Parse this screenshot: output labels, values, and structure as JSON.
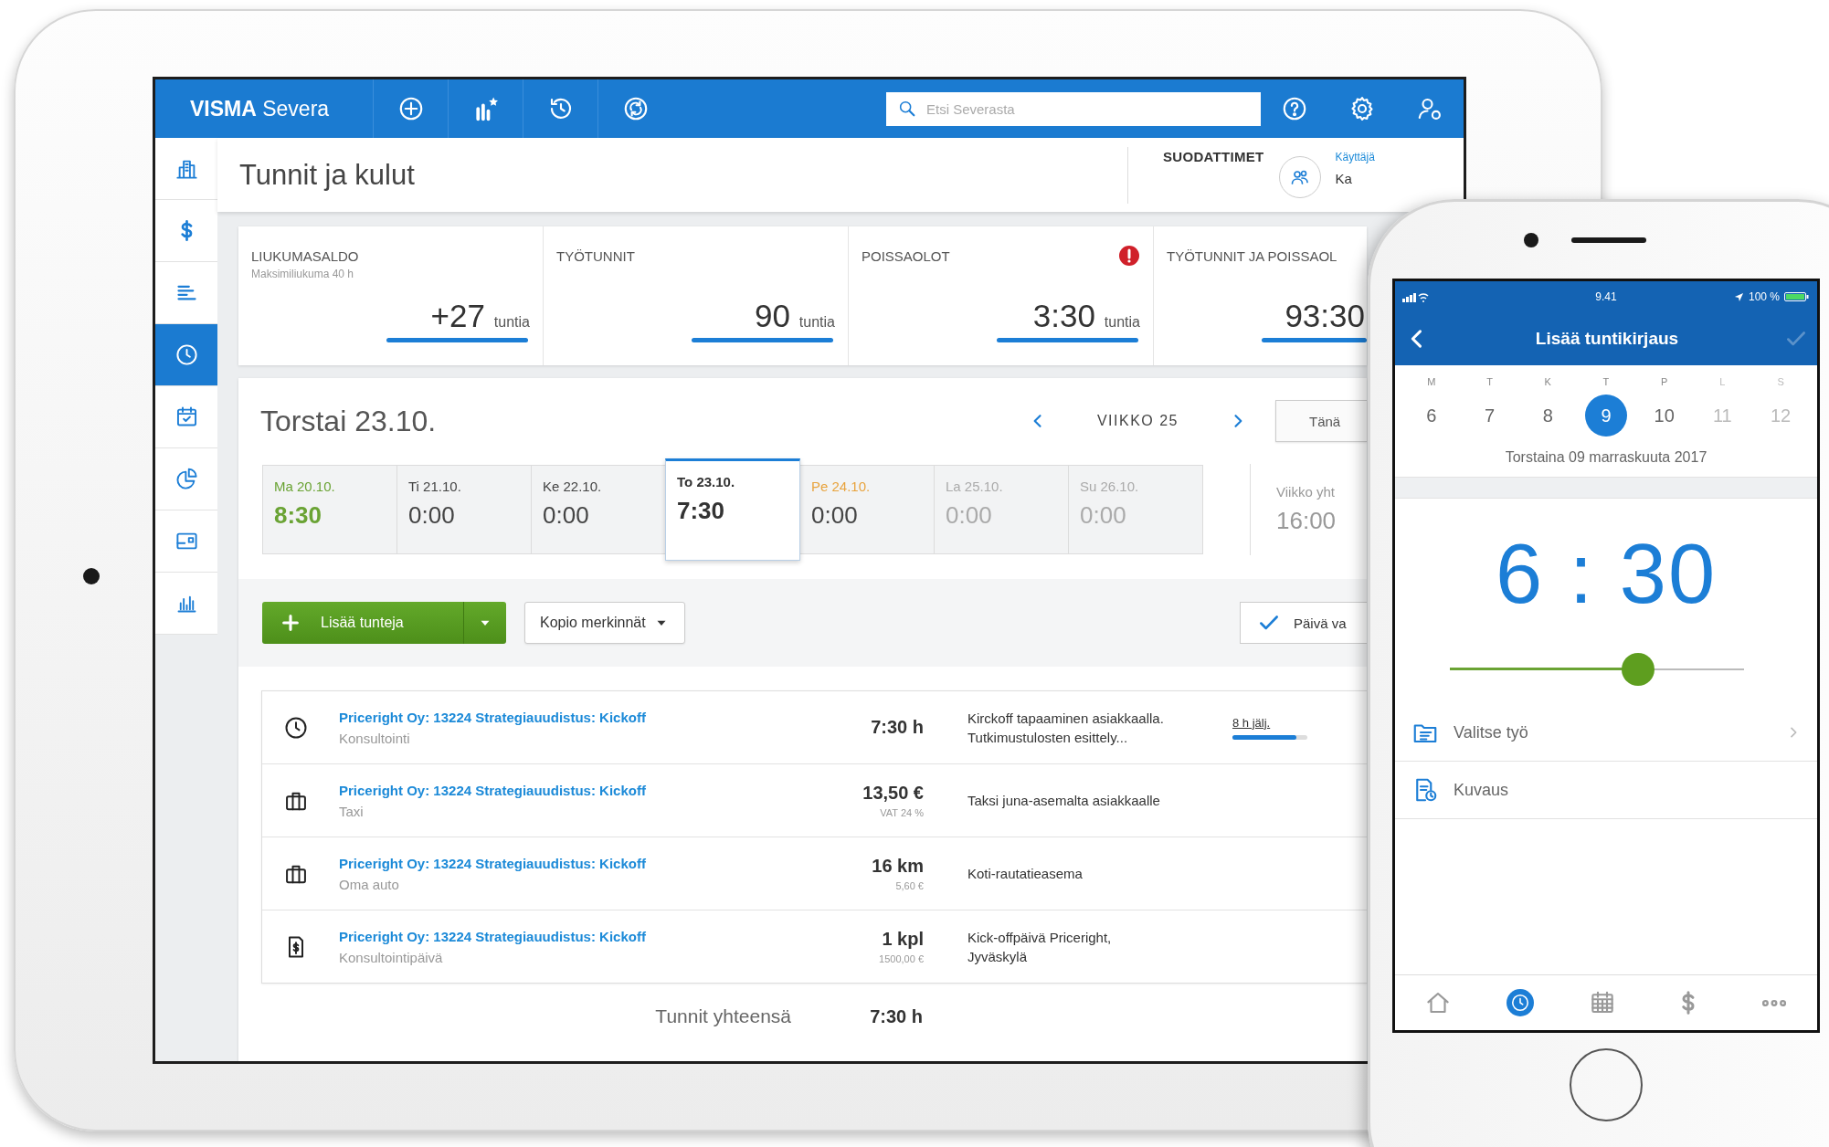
{
  "tablet": {
    "header": {
      "logo": "**VISMA** Severa",
      "actions": [
        {
          "kind": "plus-circle"
        },
        {
          "kind": "bar-chart-star"
        },
        {
          "kind": "history"
        },
        {
          "kind": "sync-circle"
        }
      ],
      "search": {
        "placeholder": "Etsi Severasta"
      },
      "tools": [
        {
          "kind": "help"
        },
        {
          "kind": "settings"
        },
        {
          "kind": "user"
        }
      ]
    },
    "sidebar": {
      "items": [
        {
          "kind": "building",
          "selected": false
        },
        {
          "kind": "dollar",
          "selected": false
        },
        {
          "kind": "list",
          "selected": false
        },
        {
          "kind": "clock",
          "selected": true
        },
        {
          "kind": "calendar-check",
          "selected": false
        },
        {
          "kind": "pie-chart",
          "selected": false
        },
        {
          "kind": "card",
          "selected": false
        },
        {
          "kind": "bar-chart",
          "selected": false
        }
      ]
    },
    "page_title": "Tunnit ja kulut",
    "filters": {
      "label": "SUODATTIMET",
      "user_label": "Käyttäjä",
      "user_value": "Ka"
    },
    "summary": [
      {
        "label": "LIUKUMASALDO",
        "sublabel": "Maksimiliukuma  40 h",
        "value": "+27",
        "unit": "tuntia",
        "alert": false
      },
      {
        "label": "TYÖTUNNIT",
        "value": "90",
        "unit": "tuntia",
        "alert": false
      },
      {
        "label": "POISSAOLOT",
        "value": "3:30",
        "unit": "tuntia",
        "alert": true
      },
      {
        "label": "TYÖTUNNIT JA POISSAOL",
        "value": "93:30",
        "alert": false
      }
    ],
    "day": {
      "title": "Torstai 23.10.",
      "week_label": "VIIKKO 25",
      "today_button": "Tänä",
      "days": [
        {
          "label": "Ma 20.10.",
          "value": "8:30",
          "kind": "complete",
          "selected": false
        },
        {
          "label": "Ti 21.10.",
          "value": "0:00",
          "kind": "normal",
          "selected": false
        },
        {
          "label": "Ke 22.10.",
          "value": "0:00",
          "kind": "normal",
          "selected": false
        },
        {
          "label": "To 23.10.",
          "value": "7:30",
          "kind": "normal",
          "selected": true
        },
        {
          "label": "Pe 24.10.",
          "value": "0:00",
          "kind": "pending",
          "selected": false
        },
        {
          "label": "La 25.10.",
          "value": "0:00",
          "kind": "weekend",
          "selected": false
        },
        {
          "label": "Su 26.10.",
          "value": "0:00",
          "kind": "weekend",
          "selected": false
        }
      ],
      "week_total": {
        "label": "Viikko yht",
        "value": "16:00"
      }
    },
    "buttons": {
      "add": "Lisää tunteja",
      "copy": "Kopio merkinnät",
      "approve": "Päivä va"
    },
    "entries": [
      {
        "kind": "clock",
        "title": "Priceright Oy: 13224 Strategiauudistus: Kickoff",
        "subtitle": "Konsultointi",
        "amount": "7:30 h",
        "description": "Kirckoff tapaaminen asiakkaalla.\nTutkimustulosten esittely...",
        "remaining": {
          "label": "8 h jälj.",
          "level": 0.85
        }
      },
      {
        "kind": "briefcase",
        "title": "Priceright Oy: 13224 Strategiauudistus: Kickoff",
        "subtitle": "Taxi",
        "amount": "13,50 €",
        "amount_note": "VAT 24 %",
        "description": "Taksi juna-asemalta asiakkaalle"
      },
      {
        "kind": "briefcase",
        "title": "Priceright Oy: 13224 Strategiauudistus: Kickoff",
        "subtitle": "Oma auto",
        "amount": "16 km",
        "amount_note": "5,60 €",
        "description": "Koti-rautatieasema"
      },
      {
        "kind": "invoice",
        "title": "Priceright Oy: 13224 Strategiauudistus: Kickoff",
        "subtitle": "Konsultointipäivä",
        "amount": "1 kpl",
        "amount_note": "1500,00 €",
        "description": "Kick-offpäivä Priceright,\nJyväskylä"
      }
    ],
    "total": {
      "label": "Tunnit yhteensä",
      "value": "7:30 h"
    }
  },
  "phone": {
    "status_bar": {
      "time": "9.41",
      "battery": "100 %"
    },
    "title": "Lisää tuntikirjaus",
    "confirm_enabled": false,
    "week": [
      {
        "letter": "M",
        "number": "6",
        "selected": false,
        "dimmed": false
      },
      {
        "letter": "T",
        "number": "7",
        "selected": false,
        "dimmed": false
      },
      {
        "letter": "K",
        "number": "8",
        "selected": false,
        "dimmed": false
      },
      {
        "letter": "T",
        "number": "9",
        "selected": true,
        "dimmed": false
      },
      {
        "letter": "P",
        "number": "10",
        "selected": false,
        "dimmed": false
      },
      {
        "letter": "L",
        "number": "11",
        "selected": false,
        "dimmed": true
      },
      {
        "letter": "S",
        "number": "12",
        "selected": false,
        "dimmed": true
      }
    ],
    "date": "Torstaina 09 marraskuuta 2017",
    "time": "6 : 30",
    "slider": {
      "level": 0.64
    },
    "rows": [
      {
        "kind": "folder-list",
        "label": "Valitse työ",
        "chevron": true
      },
      {
        "kind": "document-clock",
        "label": "Kuvaus",
        "chevron": false
      }
    ],
    "tabs": [
      {
        "kind": "home",
        "selected": false
      },
      {
        "kind": "clock",
        "selected": true
      },
      {
        "kind": "calendar",
        "selected": false
      },
      {
        "kind": "dollar",
        "selected": false
      },
      {
        "kind": "more",
        "selected": false
      }
    ]
  }
}
